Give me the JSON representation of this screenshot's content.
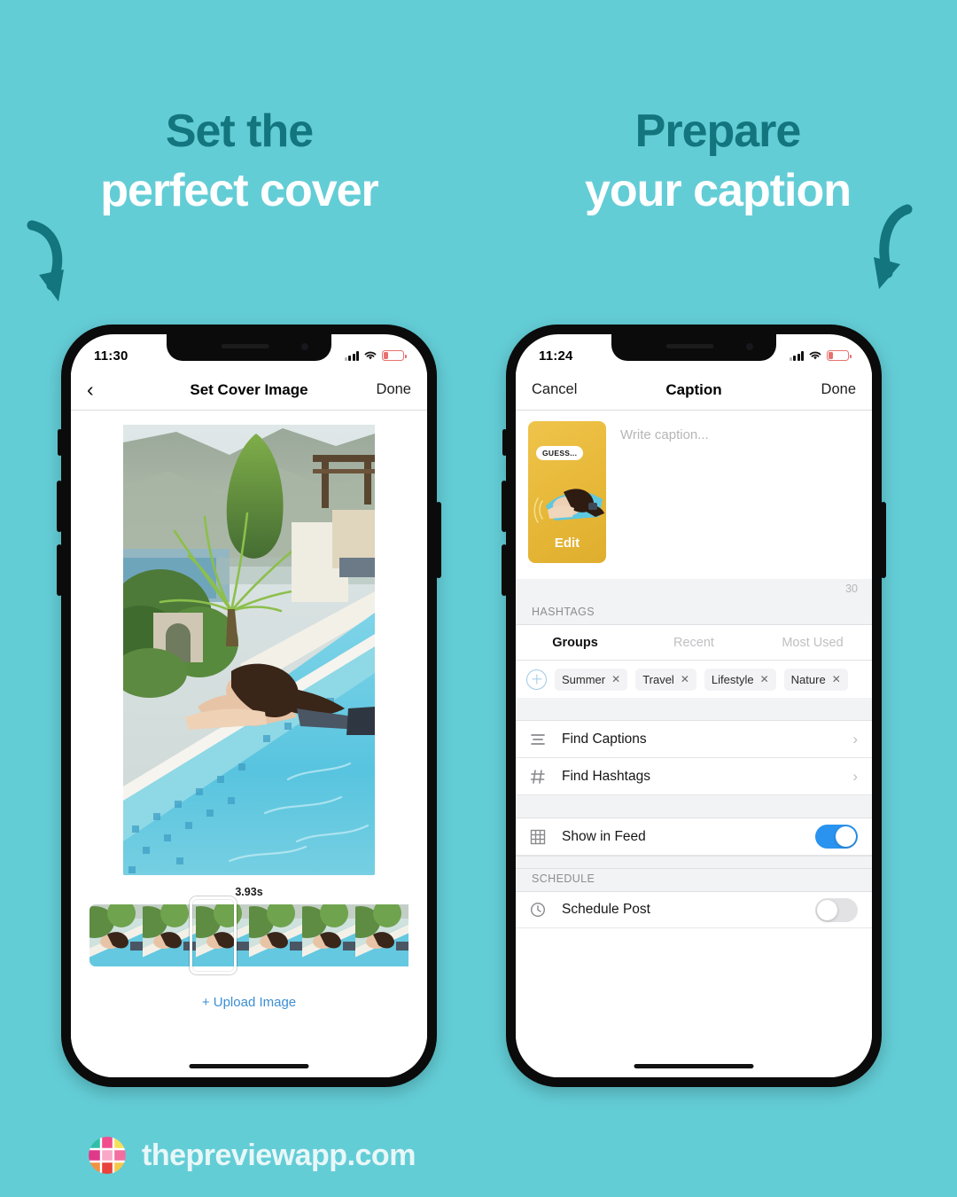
{
  "background_color": "#63cdd6",
  "headings": [
    {
      "line1": "Set the",
      "line2": "perfect cover"
    },
    {
      "line1": "Prepare",
      "line2": "your caption"
    }
  ],
  "left_phone": {
    "status": {
      "time": "11:30",
      "signal_icon": "signal-bars-icon",
      "wifi_icon": "wifi-icon",
      "battery_icon": "battery-low-icon"
    },
    "nav": {
      "back_icon": "chevron-left-icon",
      "title": "Set Cover Image",
      "done_label": "Done"
    },
    "cover": {
      "alt": "woman-in-pool-photo"
    },
    "duration_label": "3.93s",
    "filmstrip_frames": 6,
    "selected_frame_index": 2,
    "upload_label": "+ Upload Image"
  },
  "right_phone": {
    "status": {
      "time": "11:24",
      "signal_icon": "signal-bars-icon",
      "wifi_icon": "wifi-icon",
      "battery_icon": "battery-low-icon"
    },
    "nav": {
      "cancel_label": "Cancel",
      "title": "Caption",
      "done_label": "Done"
    },
    "caption": {
      "placeholder": "Write caption...",
      "value": "",
      "thumb_sticker": "GUESS...",
      "thumb_edit_label": "Edit",
      "char_counter": "30"
    },
    "hashtags_section_label": "HASHTAGS",
    "tabs": [
      {
        "label": "Groups",
        "active": true
      },
      {
        "label": "Recent",
        "active": false
      },
      {
        "label": "Most Used",
        "active": false
      }
    ],
    "add_group_icon": "plus-circle-icon",
    "chips": [
      {
        "label": "Summer",
        "remove_icon": "close-icon"
      },
      {
        "label": "Travel",
        "remove_icon": "close-icon"
      },
      {
        "label": "Lifestyle",
        "remove_icon": "close-icon"
      },
      {
        "label": "Nature",
        "remove_icon": "close-icon"
      }
    ],
    "menu_rows": [
      {
        "icon": "list-lines-icon",
        "label": "Find Captions",
        "chevron": "chevron-right-icon"
      },
      {
        "icon": "hashtag-icon",
        "label": "Find Hashtags",
        "chevron": "chevron-right-icon"
      }
    ],
    "feed_row": {
      "icon": "grid-icon",
      "label": "Show in Feed",
      "toggle_on": true
    },
    "schedule_section_label": "SCHEDULE",
    "schedule_row": {
      "icon": "clock-icon",
      "label": "Schedule Post",
      "toggle_on": false
    }
  },
  "footer": {
    "brand": "thepreviewapp.com",
    "logo_icon": "preview-grid-logo-icon"
  },
  "colors": {
    "teal_bg": "#63cdd6",
    "teal_dark": "#13757e",
    "white": "#ffffff",
    "ios_blue": "#2a93f0",
    "link_blue": "#3b8fd4",
    "thumb_gold": "#e8b93a"
  }
}
